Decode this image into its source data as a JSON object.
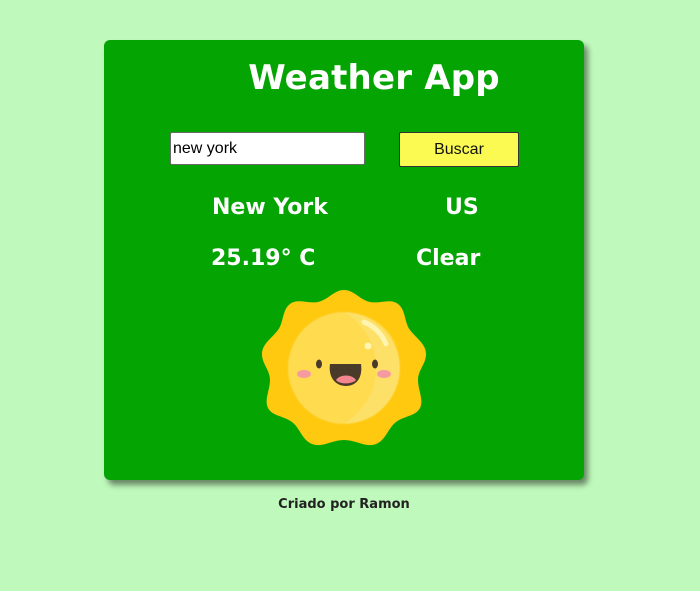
{
  "app": {
    "title": "Weather App"
  },
  "search": {
    "value": "new york",
    "button_label": "Buscar"
  },
  "weather": {
    "city": "New York",
    "country": "US",
    "temperature": "25.19° C",
    "description": "Clear",
    "icon": "smiling-sun-icon"
  },
  "footer": {
    "text": "Criado por Ramon"
  },
  "colors": {
    "page_background": "#bff9bb",
    "card_background": "#04a503",
    "button_background": "#fbfa52",
    "text_on_card": "#ffffff"
  }
}
